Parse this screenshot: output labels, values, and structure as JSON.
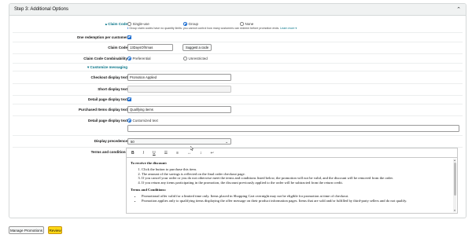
{
  "panel": {
    "title": "Step 3: Additional Options",
    "collapse_icon": "chevron-up-icon"
  },
  "claim_code": {
    "label": "▴ Claim Code",
    "options": [
      "Single-use",
      "Group",
      "None"
    ],
    "selected": "Group",
    "note": "Group claim codes have no quantity limits: you cannot control how many customers can redeem before promotion ends.",
    "note_link": "Learn more ▾"
  },
  "one_redemption": {
    "label": "One redemption per customer",
    "checked": true
  },
  "claim_code_field": {
    "label": "Claim Code",
    "value": "13DaysOfXmas",
    "suggest_button": "Suggest a code"
  },
  "combinability": {
    "label": "Claim Code Combinability",
    "options": [
      "Preferential",
      "Unrestricted"
    ],
    "selected": "Preferential"
  },
  "customize_messaging": {
    "label": "▾ Customize messaging"
  },
  "checkout_display": {
    "label": "Checkout display text",
    "value": "Promotion Applied"
  },
  "short_display": {
    "label": "Short display text",
    "value": ""
  },
  "detail_page_display": {
    "label": "Detail page display text",
    "checked": true
  },
  "purchased_items": {
    "label": "Purchased Items display text",
    "value": "Qualifying items"
  },
  "detail_page_text": {
    "label": "Detail page display text",
    "option": "Customized text",
    "value": ""
  },
  "display_precedence": {
    "label": "Display precedence",
    "value": "50"
  },
  "terms": {
    "label": "Terms and conditions",
    "toolbar": [
      "B",
      "I",
      "U",
      "☰",
      "≡",
      "↔",
      "↕",
      "↩"
    ],
    "heading1": "To receive the discount:",
    "steps": [
      "Click the button to purchase this item.",
      "The amount of the savings is reflected on the final order checkout page.",
      "If you cancel your order or you do not otherwise meet the terms and conditions listed below, the promotion will not be valid, and the discount will be removed from the order.",
      "If you return any items participating in the promotion, the discount previously applied to the order will be subtracted from the return credit."
    ],
    "heading2": "Terms and Conditions:",
    "bullets": [
      "Promotional offer valid for a limited time only. Items placed in Shopping Cart overnight may not be eligible for promotion at time of checkout.",
      "Promotion applies only to qualifying items displaying the offer message on their product information pages. Items that are sold and/or fulfilled by third-party sellers and do not qualify."
    ]
  },
  "footer": {
    "manage_button": "Manage Promotions",
    "review_button": "Review"
  },
  "colors": {
    "accent": "#1f6fd1",
    "link": "#007185",
    "primary_button": "#ffd814"
  }
}
